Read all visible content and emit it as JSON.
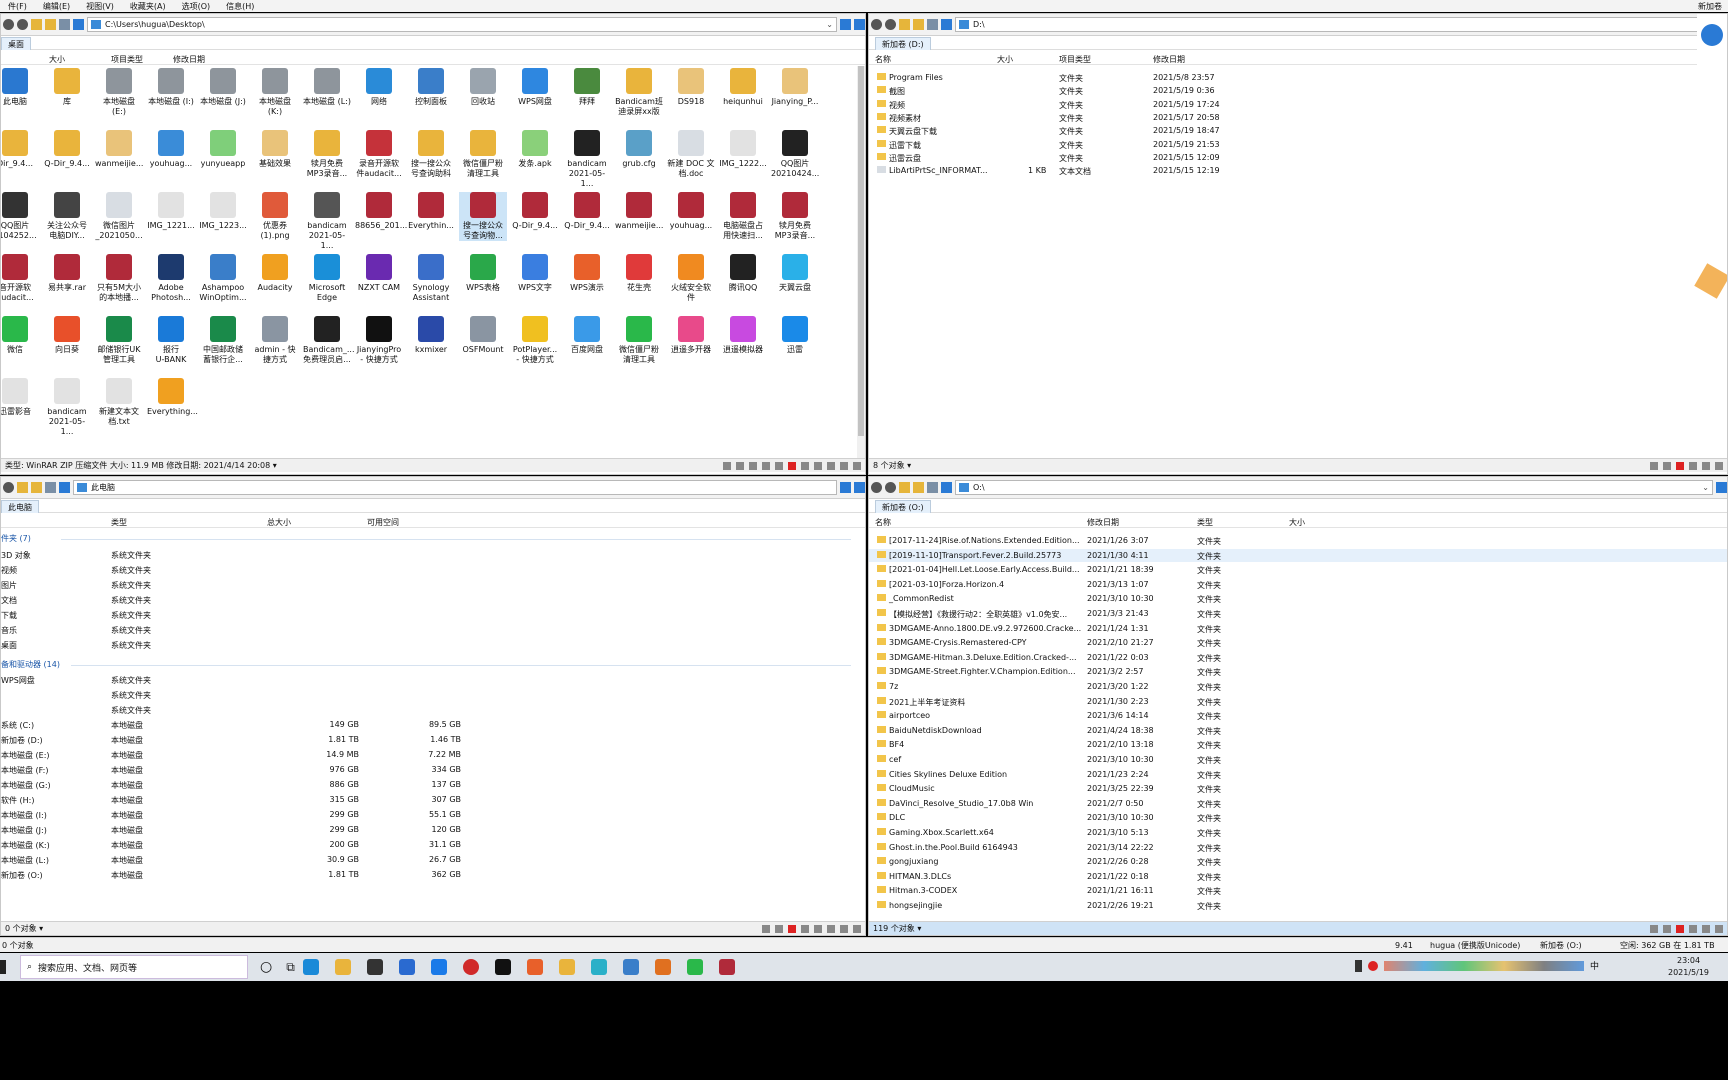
{
  "menu": {
    "items": [
      "件(F)",
      "编辑(E)",
      "视图(V)",
      "收藏夹(A)",
      "选项(O)",
      "信息(H)"
    ],
    "right_label": "新加卷"
  },
  "p1": {
    "path": "C:\\Users\\hugua\\Desktop\\",
    "tab": "桌面",
    "cols": [
      "大小",
      "项目类型",
      "修改日期"
    ],
    "icons": [
      {
        "l1": "此电脑",
        "l2": "",
        "c": "#2a78d0"
      },
      {
        "l1": "库",
        "l2": "",
        "c": "#e9b43c"
      },
      {
        "l1": "本地磁盘 (E:)",
        "l2": "",
        "c": "#8e959c"
      },
      {
        "l1": "本地磁盘 (I:)",
        "l2": "",
        "c": "#8e959c"
      },
      {
        "l1": "本地磁盘 (J:)",
        "l2": "",
        "c": "#8e959c"
      },
      {
        "l1": "本地磁盘 (K:)",
        "l2": "",
        "c": "#8e959c"
      },
      {
        "l1": "本地磁盘 (L:)",
        "l2": "",
        "c": "#8e959c"
      },
      {
        "l1": "网络",
        "l2": "",
        "c": "#2a8bd8"
      },
      {
        "l1": "控制面板",
        "l2": "",
        "c": "#3a7ec9"
      },
      {
        "l1": "回收站",
        "l2": "",
        "c": "#9aa4ae"
      },
      {
        "l1": "WPS网盘",
        "l2": "",
        "c": "#2e87e0"
      },
      {
        "l1": "拜拜",
        "l2": "",
        "c": "#4a8a3e"
      },
      {
        "l1": "Bandicam班",
        "l2": "迪录屏xx版",
        "c": "#e9b43c"
      },
      {
        "l1": "DS918",
        "l2": "",
        "c": "#e9c37a"
      },
      {
        "l1": "heiqunhui",
        "l2": "",
        "c": "#e9b43c"
      },
      {
        "l1": "Jianying_P...",
        "l2": "",
        "c": "#e9c37a"
      },
      {
        "l1": "Dir_9.4...",
        "l2": "",
        "c": "#e9b43c"
      },
      {
        "l1": "Q-Dir_9.4...",
        "l2": "",
        "c": "#e9b43c"
      },
      {
        "l1": "wanmeijie...",
        "l2": "",
        "c": "#e9c37a"
      },
      {
        "l1": "youhuag...",
        "l2": "",
        "c": "#3a8cd8"
      },
      {
        "l1": "yunyueapp",
        "l2": "",
        "c": "#7fcf7a"
      },
      {
        "l1": "基础效果",
        "l2": "",
        "c": "#e9c37a"
      },
      {
        "l1": "犊月免费",
        "l2": "MP3录音...",
        "c": "#e9b43c"
      },
      {
        "l1": "录音开源软",
        "l2": "件audacit...",
        "c": "#c5323a"
      },
      {
        "l1": "搜一搜公众",
        "l2": "号查询助科",
        "c": "#e9b43c"
      },
      {
        "l1": "微信僵尸粉",
        "l2": "清理工具",
        "c": "#e9b43c"
      },
      {
        "l1": "发条.apk",
        "l2": "",
        "c": "#8ad07a"
      },
      {
        "l1": "bandicam",
        "l2": "2021-05-1...",
        "c": "#222222"
      },
      {
        "l1": "grub.cfg",
        "l2": "",
        "c": "#5aa0c8"
      },
      {
        "l1": "新建 DOC 文",
        "l2": "档.doc",
        "c": "#d8dde3"
      },
      {
        "l1": "IMG_1222...",
        "l2": "",
        "c": "#e2e2e2"
      },
      {
        "l1": "QQ图片",
        "l2": "20210424...",
        "c": "#222222"
      },
      {
        "l1": "QQ图片",
        "l2": "2104252...",
        "c": "#333333"
      },
      {
        "l1": "关注公众号",
        "l2": "电脑DIY...",
        "c": "#444444"
      },
      {
        "l1": "微信图片",
        "l2": "_2021050...",
        "c": "#d8dde3"
      },
      {
        "l1": "IMG_1221...",
        "l2": "",
        "c": "#e2e2e2"
      },
      {
        "l1": "IMG_1223...",
        "l2": "",
        "c": "#e2e2e2"
      },
      {
        "l1": "优惠券",
        "l2": "(1).png",
        "c": "#e05a3a"
      },
      {
        "l1": "bandicam",
        "l2": "2021-05-1...",
        "c": "#555555"
      },
      {
        "l1": "88656_201...",
        "l2": "",
        "c": "#b02a3a"
      },
      {
        "l1": "Everythin...",
        "l2": "",
        "c": "#b02a3a"
      },
      {
        "l1": "搜一搜公众",
        "l2": "号查询物...",
        "c": "#b02a3a"
      },
      {
        "l1": "Q-Dir_9.4...",
        "l2": "",
        "c": "#b02a3a"
      },
      {
        "l1": "Q-Dir_9.4...",
        "l2": "",
        "c": "#b02a3a"
      },
      {
        "l1": "wanmeijie...",
        "l2": "",
        "c": "#b02a3a"
      },
      {
        "l1": "youhuag...",
        "l2": "",
        "c": "#b02a3a"
      },
      {
        "l1": "电脑磁盘占",
        "l2": "用快速扫...",
        "c": "#b02a3a"
      },
      {
        "l1": "犊月免费",
        "l2": "MP3录音...",
        "c": "#b02a3a"
      },
      {
        "l1": "音开源软",
        "l2": "audacit...",
        "c": "#b02a3a"
      },
      {
        "l1": "易共享.rar",
        "l2": "",
        "c": "#b02a3a"
      },
      {
        "l1": "只有5M大小",
        "l2": "的本地播...",
        "c": "#b02a3a"
      },
      {
        "l1": "Adobe",
        "l2": "Photosh...",
        "c": "#1d3a6e"
      },
      {
        "l1": "Ashampoo",
        "l2": "WinOptim...",
        "c": "#3a7ec9"
      },
      {
        "l1": "Audacity",
        "l2": "",
        "c": "#f0a020"
      },
      {
        "l1": "Microsoft",
        "l2": "Edge",
        "c": "#1a8fd8"
      },
      {
        "l1": "NZXT CAM",
        "l2": "",
        "c": "#6a2ab0"
      },
      {
        "l1": "Synology",
        "l2": "Assistant",
        "c": "#3a6ec9"
      },
      {
        "l1": "WPS表格",
        "l2": "",
        "c": "#2aa84a"
      },
      {
        "l1": "WPS文字",
        "l2": "",
        "c": "#3a7ee0"
      },
      {
        "l1": "WPS演示",
        "l2": "",
        "c": "#e8602a"
      },
      {
        "l1": "花生壳",
        "l2": "",
        "c": "#e03a3a"
      },
      {
        "l1": "火绒安全软",
        "l2": "件",
        "c": "#f08a20"
      },
      {
        "l1": "腾讯QQ",
        "l2": "",
        "c": "#222222"
      },
      {
        "l1": "天翼云盘",
        "l2": "",
        "c": "#2ab0e8"
      },
      {
        "l1": "微信",
        "l2": "",
        "c": "#2ab84a"
      },
      {
        "l1": "向日葵",
        "l2": "",
        "c": "#e8502a"
      },
      {
        "l1": "邮储银行UK",
        "l2": "管理工具",
        "c": "#1a8a4a"
      },
      {
        "l1": "报行",
        "l2": "U-BANK",
        "c": "#1a7ad8"
      },
      {
        "l1": "中国邮政储",
        "l2": "蓄银行企...",
        "c": "#1a8a4a"
      },
      {
        "l1": "admin - 快",
        "l2": "捷方式",
        "c": "#8a95a2"
      },
      {
        "l1": "Bandicam_...",
        "l2": "免费理员启...",
        "c": "#222222"
      },
      {
        "l1": "JianyingPro",
        "l2": "- 快捷方式",
        "c": "#111111"
      },
      {
        "l1": "kxmixer",
        "l2": "",
        "c": "#2a4aa8"
      },
      {
        "l1": "OSFMount",
        "l2": "",
        "c": "#8a95a2"
      },
      {
        "l1": "PotPlayer...",
        "l2": "- 快捷方式",
        "c": "#f0c020"
      },
      {
        "l1": "百度网盘",
        "l2": "",
        "c": "#3a9ae8"
      },
      {
        "l1": "微信僵尸粉",
        "l2": "清理工具",
        "c": "#2ab84a"
      },
      {
        "l1": "逍遥多开器",
        "l2": "",
        "c": "#e84a8a"
      },
      {
        "l1": "逍遥模拟器",
        "l2": "",
        "c": "#c84ae0"
      },
      {
        "l1": "迅雷",
        "l2": "",
        "c": "#1a8ae8"
      },
      {
        "l1": "迅雷影音",
        "l2": "",
        "c": "#e2e2e2"
      },
      {
        "l1": "bandicam",
        "l2": "2021-05-1...",
        "c": "#e2e2e2"
      },
      {
        "l1": "新建文本文",
        "l2": "档.txt",
        "c": "#e2e2e2"
      },
      {
        "l1": "Everything...",
        "l2": "",
        "c": "#f0a020"
      }
    ],
    "status": "类型: WinRAR ZIP 压缩文件 大小: 11.9 MB 修改日期: 2021/4/14 20:08 ▾"
  },
  "p2": {
    "path": "D:\\",
    "tab": "新加卷 (D:)",
    "cols": [
      "名称",
      "大小",
      "项目类型",
      "修改日期"
    ],
    "rows": [
      {
        "n": "Program Files",
        "s": "",
        "t": "文件夹",
        "d": "2021/5/8 23:57"
      },
      {
        "n": "截图",
        "s": "",
        "t": "文件夹",
        "d": "2021/5/19 0:36"
      },
      {
        "n": "视频",
        "s": "",
        "t": "文件夹",
        "d": "2021/5/19 17:24"
      },
      {
        "n": "视频素材",
        "s": "",
        "t": "文件夹",
        "d": "2021/5/17 20:58"
      },
      {
        "n": "天翼云盘下载",
        "s": "",
        "t": "文件夹",
        "d": "2021/5/19 18:47"
      },
      {
        "n": "迅雷下载",
        "s": "",
        "t": "文件夹",
        "d": "2021/5/19 21:53"
      },
      {
        "n": "迅雷云盘",
        "s": "",
        "t": "文件夹",
        "d": "2021/5/15 12:09"
      },
      {
        "n": "LibArtiPrtSc_INFORMAT...",
        "s": "1 KB",
        "t": "文本文档",
        "d": "2021/5/15 12:19"
      }
    ],
    "status": "8 个对象 ▾"
  },
  "p3": {
    "path": "此电脑",
    "tab": "此电脑",
    "cols": [
      "类型",
      "总大小",
      "可用空间"
    ],
    "g1": "件夹 (7)",
    "folders": [
      {
        "n": "3D 对象",
        "t": "系统文件夹"
      },
      {
        "n": "视频",
        "t": "系统文件夹"
      },
      {
        "n": "图片",
        "t": "系统文件夹"
      },
      {
        "n": "文档",
        "t": "系统文件夹"
      },
      {
        "n": "下载",
        "t": "系统文件夹"
      },
      {
        "n": "音乐",
        "t": "系统文件夹"
      },
      {
        "n": "桌面",
        "t": "系统文件夹"
      }
    ],
    "g2": "备和驱动器 (14)",
    "drives": [
      {
        "n": "WPS网盘",
        "t": "系统文件夹",
        "s": "",
        "f": ""
      },
      {
        "n": "",
        "t": "系统文件夹",
        "s": "",
        "f": ""
      },
      {
        "n": "",
        "t": "系统文件夹",
        "s": "",
        "f": ""
      },
      {
        "n": "系统 (C:)",
        "t": "本地磁盘",
        "s": "149 GB",
        "f": "89.5 GB"
      },
      {
        "n": "新加卷 (D:)",
        "t": "本地磁盘",
        "s": "1.81 TB",
        "f": "1.46 TB"
      },
      {
        "n": "本地磁盘 (E:)",
        "t": "本地磁盘",
        "s": "14.9 MB",
        "f": "7.22 MB"
      },
      {
        "n": "本地磁盘 (F:)",
        "t": "本地磁盘",
        "s": "976 GB",
        "f": "334 GB"
      },
      {
        "n": "本地磁盘 (G:)",
        "t": "本地磁盘",
        "s": "886 GB",
        "f": "137 GB"
      },
      {
        "n": "软件 (H:)",
        "t": "本地磁盘",
        "s": "315 GB",
        "f": "307 GB"
      },
      {
        "n": "本地磁盘 (I:)",
        "t": "本地磁盘",
        "s": "299 GB",
        "f": "55.1 GB"
      },
      {
        "n": "本地磁盘 (J:)",
        "t": "本地磁盘",
        "s": "299 GB",
        "f": "120 GB"
      },
      {
        "n": "本地磁盘 (K:)",
        "t": "本地磁盘",
        "s": "200 GB",
        "f": "31.1 GB"
      },
      {
        "n": "本地磁盘 (L:)",
        "t": "本地磁盘",
        "s": "30.9 GB",
        "f": "26.7 GB"
      },
      {
        "n": "新加卷 (O:)",
        "t": "本地磁盘",
        "s": "1.81 TB",
        "f": "362 GB"
      }
    ],
    "status": "0 个对象 ▾"
  },
  "p4": {
    "path": "O:\\",
    "tab": "新加卷 (O:)",
    "cols": [
      "名称",
      "修改日期",
      "类型",
      "大小"
    ],
    "rows": [
      {
        "n": "[2017-11-24]Rise.of.Nations.Extended.Edition...",
        "d": "2021/1/26 3:07",
        "t": "文件夹"
      },
      {
        "n": "[2019-11-10]Transport.Fever.2.Build.25773",
        "d": "2021/1/30 4:11",
        "t": "文件夹"
      },
      {
        "n": "[2021-01-04]Hell.Let.Loose.Early.Access.Build...",
        "d": "2021/1/21 18:39",
        "t": "文件夹"
      },
      {
        "n": "[2021-03-10]Forza.Horizon.4",
        "d": "2021/3/13 1:07",
        "t": "文件夹"
      },
      {
        "n": "_CommonRedist",
        "d": "2021/3/10 10:30",
        "t": "文件夹"
      },
      {
        "n": "【模拟经营】《救援行动2：全职英雄》v1.0免安...",
        "d": "2021/3/3 21:43",
        "t": "文件夹"
      },
      {
        "n": "3DMGAME-Anno.1800.DE.v9.2.972600.Cracke...",
        "d": "2021/1/24 1:31",
        "t": "文件夹"
      },
      {
        "n": "3DMGAME-Crysis.Remastered-CPY",
        "d": "2021/2/10 21:27",
        "t": "文件夹"
      },
      {
        "n": "3DMGAME-Hitman.3.Deluxe.Edition.Cracked-...",
        "d": "2021/1/22 0:03",
        "t": "文件夹"
      },
      {
        "n": "3DMGAME-Street.Fighter.V.Champion.Edition...",
        "d": "2021/3/2 2:57",
        "t": "文件夹"
      },
      {
        "n": "7z",
        "d": "2021/3/20 1:22",
        "t": "文件夹"
      },
      {
        "n": "2021上半年考证资料",
        "d": "2021/1/30 2:23",
        "t": "文件夹"
      },
      {
        "n": "airportceo",
        "d": "2021/3/6 14:14",
        "t": "文件夹"
      },
      {
        "n": "BaiduNetdiskDownload",
        "d": "2021/4/24 18:38",
        "t": "文件夹"
      },
      {
        "n": "BF4",
        "d": "2021/2/10 13:18",
        "t": "文件夹"
      },
      {
        "n": "cef",
        "d": "2021/3/10 10:30",
        "t": "文件夹"
      },
      {
        "n": "Cities Skylines Deluxe Edition",
        "d": "2021/1/23 2:24",
        "t": "文件夹"
      },
      {
        "n": "CloudMusic",
        "d": "2021/3/25 22:39",
        "t": "文件夹"
      },
      {
        "n": "DaVinci_Resolve_Studio_17.0b8 Win",
        "d": "2021/2/7 0:50",
        "t": "文件夹"
      },
      {
        "n": "DLC",
        "d": "2021/3/10 10:30",
        "t": "文件夹"
      },
      {
        "n": "Gaming.Xbox.Scarlett.x64",
        "d": "2021/3/10 5:13",
        "t": "文件夹"
      },
      {
        "n": "Ghost.in.the.Pool.Build 6164943",
        "d": "2021/3/14 22:22",
        "t": "文件夹"
      },
      {
        "n": "gongjuxiang",
        "d": "2021/2/26 0:28",
        "t": "文件夹"
      },
      {
        "n": "HITMAN.3.DLCs",
        "d": "2021/1/22 0:18",
        "t": "文件夹"
      },
      {
        "n": "Hitman.3-CODEX",
        "d": "2021/1/21 16:11",
        "t": "文件夹"
      },
      {
        "n": "hongsejingjie",
        "d": "2021/2/26 19:21",
        "t": "文件夹"
      }
    ],
    "status": "119 个对象 ▾"
  },
  "bottom": {
    "left": "0 个对象",
    "mid1": "9.41",
    "mid2": "hugua (便携版Unicode)",
    "mid3": "新加卷 (O:)",
    "right": "空闲: 362 GB 在 1.81 TB"
  },
  "taskbar": {
    "search": "搜索应用、文档、网页等",
    "time": "23:04",
    "date": "2021/5/19",
    "ime": "中"
  }
}
